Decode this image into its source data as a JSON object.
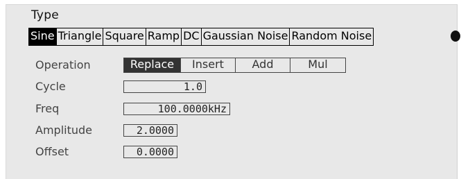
{
  "section_title": "Type",
  "waveforms": [
    {
      "label": "Sine",
      "selected": true
    },
    {
      "label": "Triangle",
      "selected": false
    },
    {
      "label": "Square",
      "selected": false
    },
    {
      "label": "Ramp",
      "selected": false
    },
    {
      "label": "DC",
      "selected": false
    },
    {
      "label": "Gaussian Noise",
      "selected": false
    },
    {
      "label": "Random Noise",
      "selected": false
    }
  ],
  "more_icon": "more-options-icon",
  "operation": {
    "label": "Operation",
    "options": [
      {
        "label": "Replace",
        "selected": true
      },
      {
        "label": "Insert",
        "selected": false
      },
      {
        "label": "Add",
        "selected": false
      },
      {
        "label": "Mul",
        "selected": false
      }
    ]
  },
  "fields": {
    "cycle": {
      "label": "Cycle",
      "value": "1.0"
    },
    "freq": {
      "label": "Freq",
      "value": "100.0000kHz"
    },
    "amplitude": {
      "label": "Amplitude",
      "value": "2.0000"
    },
    "offset": {
      "label": "Offset",
      "value": "0.0000"
    }
  },
  "colors": {
    "panel_background": "#e8e8e8",
    "selected_background": "#000000",
    "selected_text": "#ffffff"
  }
}
